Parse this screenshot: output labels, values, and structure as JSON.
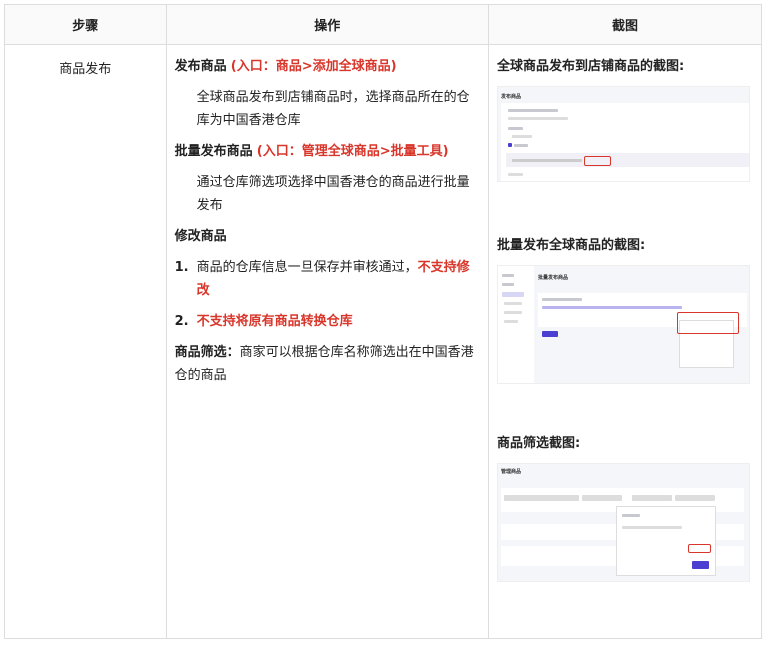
{
  "table": {
    "headers": [
      "步骤",
      "操作",
      "截图"
    ],
    "step": "商品发布",
    "ops": {
      "publish_title": "发布商品",
      "publish_entry": "(入口：商品>添加全球商品)",
      "publish_desc": "全球商品发布到店铺商品时，选择商品所在的仓库为中国香港仓库",
      "batch_title": "批量发布商品",
      "batch_entry": "(入口：管理全球商品>批量工具)",
      "batch_desc": "通过仓库筛选项选择中国香港仓的商品进行批量发布",
      "modify_title": "修改商品",
      "modify_items": [
        {
          "num": "1.",
          "text": "商品的仓库信息一旦保存并审核通过，",
          "emphasis": "不支持修改"
        },
        {
          "num": "2.",
          "text": "",
          "emphasis": "不支持将原有商品转换仓库"
        }
      ],
      "filter_label": "商品筛选：",
      "filter_desc": "商家可以根据仓库名称筛选出在中国香港仓的商品"
    },
    "screenshots": [
      {
        "caption": "全球商品发布到店铺商品的截图:",
        "page_title": "发布商品"
      },
      {
        "caption": "批量发布全球商品的截图:",
        "page_title": "批量发布商品"
      },
      {
        "caption": "商品筛选截图:",
        "page_title": "管理商品"
      }
    ]
  },
  "colors": {
    "emphasis": "#d9362b",
    "primary_button": "#4b3fd1"
  }
}
